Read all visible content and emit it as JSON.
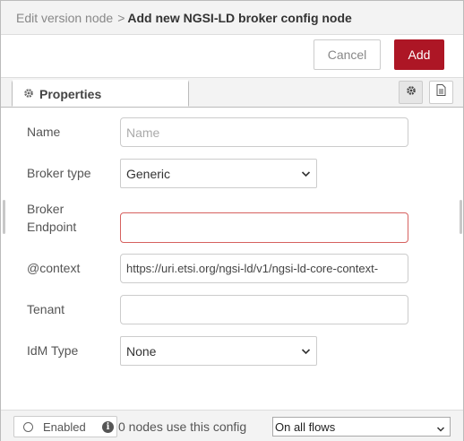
{
  "header": {
    "breadcrumb_previous": "Edit version node",
    "separator": ">",
    "title": "Add new NGSI-LD broker config node"
  },
  "buttons": {
    "cancel_label": "Cancel",
    "add_label": "Add"
  },
  "tabs": {
    "properties_label": "Properties",
    "properties_icon": "gear-icon",
    "settings_icon": "gear-icon",
    "description_icon": "document-icon"
  },
  "form": {
    "name": {
      "label": "Name",
      "placeholder": "Name",
      "value": ""
    },
    "broker_type": {
      "label": "Broker type",
      "value": "Generic"
    },
    "broker_endpoint": {
      "label_line1": "Broker",
      "label_line2": "Endpoint",
      "value": ""
    },
    "context": {
      "label": "@context",
      "value": "https://uri.etsi.org/ngsi-ld/v1/ngsi-ld-core-context-"
    },
    "tenant": {
      "label": "Tenant",
      "value": ""
    },
    "idm_type": {
      "label": "IdM Type",
      "value": "None"
    }
  },
  "footer": {
    "enabled_label": "Enabled",
    "usage_text": "0 nodes use this config",
    "scope_value": "On all flows"
  },
  "colors": {
    "primary_button": "#ad1625",
    "error_border": "#d6615f",
    "header_bg": "#f3f3f3"
  }
}
